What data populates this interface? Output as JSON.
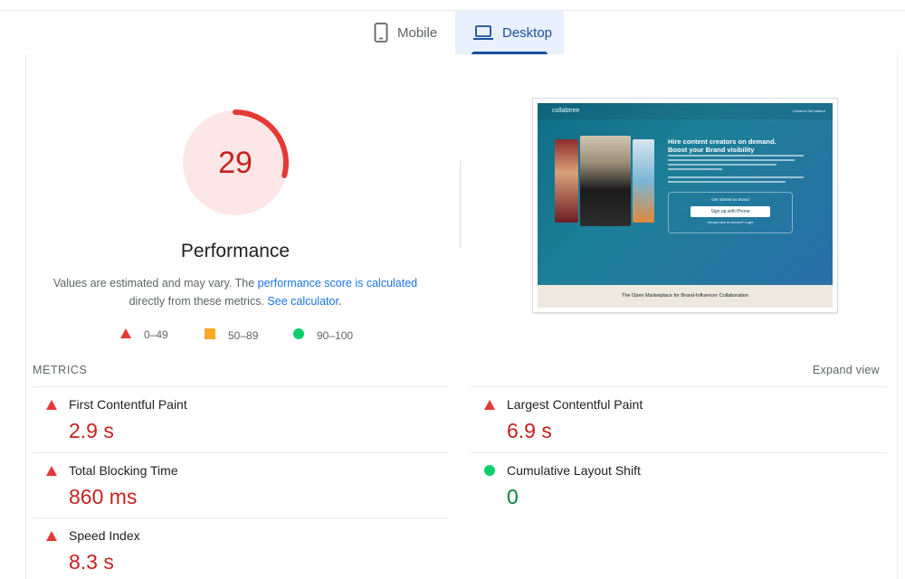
{
  "tabs": [
    {
      "label": "Mobile",
      "icon": "phone-icon",
      "selected": false
    },
    {
      "label": "Desktop",
      "icon": "laptop-icon",
      "selected": true
    }
  ],
  "score": {
    "value": 29,
    "fraction": 0.29,
    "color": "#c5221f",
    "bg_color": "#fde7e6",
    "title": "Performance"
  },
  "description": {
    "text1": "Values are estimated and may vary. The ",
    "link1": "performance score is calculated",
    "text2": "directly from these metrics. ",
    "link2": "See calculator",
    "text3": "."
  },
  "legend": [
    {
      "label": "0–49",
      "icon": "red-triangle-icon",
      "color": "#e53935"
    },
    {
      "label": "50–89",
      "icon": "orange-square-icon",
      "color": "#f9a825"
    },
    {
      "label": "90–100",
      "icon": "green-circle-icon",
      "color": "#0cce6b"
    }
  ],
  "screenshot": {
    "logo": "collabtree",
    "nav_items": "Creators   Get started",
    "heading": "Hire content creators on demand. Boost your Brand visibility",
    "box_label": "Get started as Brand",
    "box_button": "Sign up with Phone",
    "box_small": "Already have an account? Login!",
    "footer": "The Open Marketplace for Brand-Influencer Collaboration",
    "colors": {
      "hero_start": "#0f6d86",
      "hero_end": "#2a6fa8",
      "footer_bg": "#ede9df"
    }
  },
  "metrics": {
    "header": "METRICS",
    "expand": "Expand view",
    "items": [
      {
        "name": "First Contentful Paint",
        "value": "2.9 s",
        "status": "bad"
      },
      {
        "name": "Largest Contentful Paint",
        "value": "6.9 s",
        "status": "bad"
      },
      {
        "name": "Total Blocking Time",
        "value": "860 ms",
        "status": "bad"
      },
      {
        "name": "Cumulative Layout Shift",
        "value": "0",
        "status": "good"
      },
      {
        "name": "Speed Index",
        "value": "8.3 s",
        "status": "bad"
      }
    ]
  }
}
